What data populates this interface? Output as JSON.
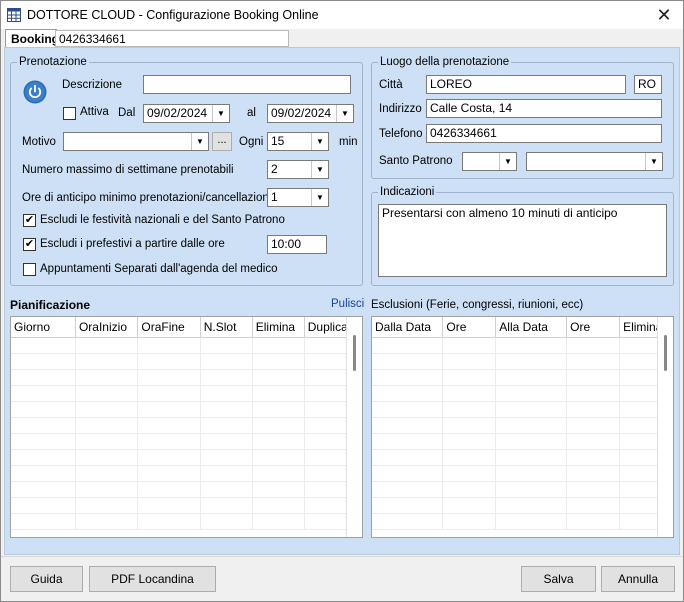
{
  "window": {
    "title": "DOTTORE CLOUD - Configurazione Booking Online",
    "close_glyph": "✕"
  },
  "tab": {
    "label": "Booking",
    "id_value": "0426334661"
  },
  "prenotazione": {
    "legend": "Prenotazione",
    "descrizione_label": "Descrizione",
    "descrizione_value": "",
    "attiva_label": "Attiva",
    "attiva_checked": false,
    "dal_label": "Dal",
    "dal_value": "09/02/2024",
    "al_label": "al",
    "al_value": "09/02/2024",
    "motivo_label": "Motivo",
    "motivo_value": "",
    "ellipsis": "...",
    "ogni_label": "Ogni",
    "ogni_value": "15",
    "min_label": "min",
    "settimane_label": "Numero massimo di settimane prenotabili",
    "settimane_value": "2",
    "anticipo_label": "Ore di anticipo minimo prenotazioni/cancellazioni",
    "anticipo_value": "1",
    "escludi_festivita_label": "Escludi le festività nazionali e del Santo Patrono",
    "escludi_festivita_checked": true,
    "escludi_prefestivi_label": "Escludi i prefestivi a partire dalle ore",
    "escludi_prefestivi_checked": true,
    "prefestivi_ora": "10:00",
    "appuntamenti_label": "Appuntamenti Separati dall'agenda del medico",
    "appuntamenti_checked": false
  },
  "luogo": {
    "legend": "Luogo della prenotazione",
    "citta_label": "Città",
    "citta_value": "LOREO",
    "provincia_value": "RO",
    "indirizzo_label": "Indirizzo",
    "indirizzo_value": "Calle Costa, 14",
    "telefono_label": "Telefono",
    "telefono_value": "0426334661",
    "santo_label": "Santo Patrono",
    "santo_day": "",
    "santo_month": ""
  },
  "indicazioni": {
    "legend": "Indicazioni",
    "text": "Presentarsi con almeno 10 minuti di anticipo"
  },
  "pianificazione": {
    "title": "Pianificazione",
    "pulisci": "Pulisci",
    "columns": [
      "Giorno",
      "OraInizio",
      "OraFine",
      "N.Slot",
      "Elimina",
      "Duplica"
    ]
  },
  "esclusioni": {
    "title": "Esclusioni (Ferie, congressi, riunioni, ecc)",
    "columns": [
      "Dalla Data",
      "Ore",
      "Alla Data",
      "Ore",
      "Elimina"
    ]
  },
  "footer": {
    "guida": "Guida",
    "pdf": "PDF Locandina",
    "salva": "Salva",
    "annulla": "Annulla"
  },
  "colors": {
    "panel_bg": "#cde0f5",
    "window_bg": "#f0f0f0",
    "accent_link": "#1a3fa0",
    "power_icon": "#2a6bb3"
  },
  "icons": {
    "app": "grid-app-icon",
    "power": "power-icon",
    "close": "close-icon",
    "dropdown": "chevron-down-icon"
  }
}
